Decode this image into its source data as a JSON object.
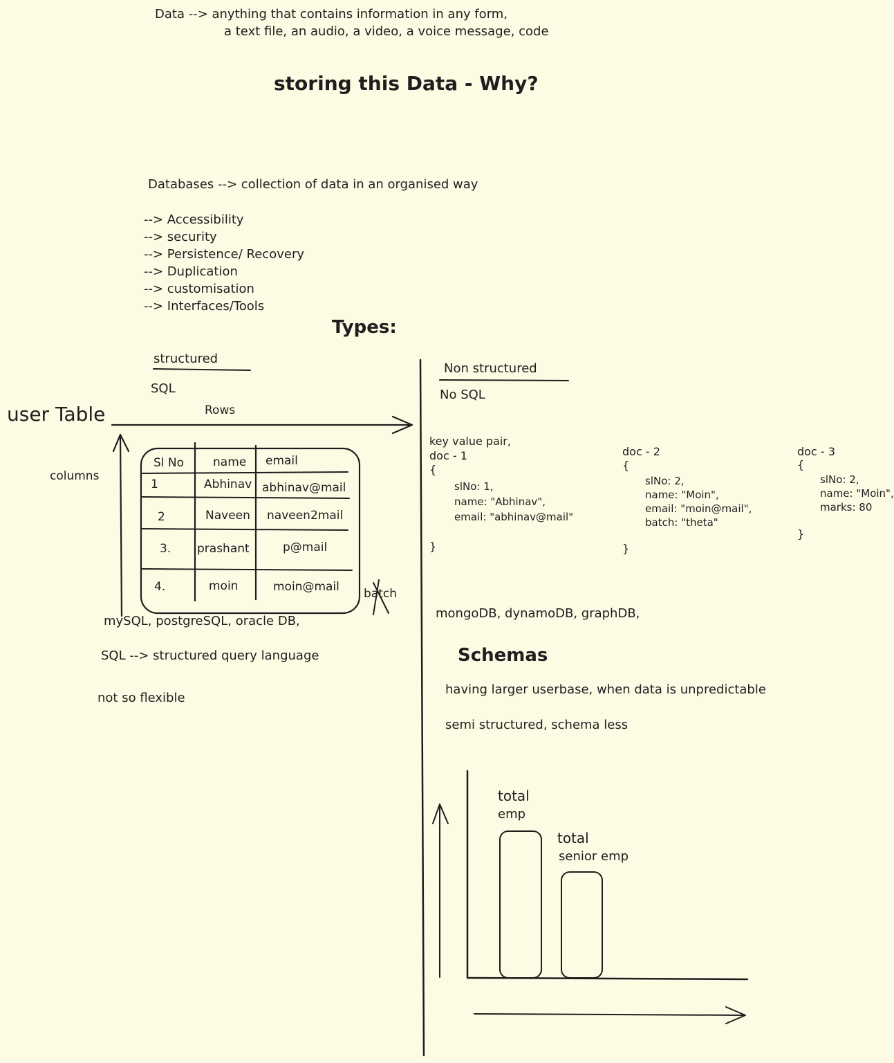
{
  "intro": {
    "line1": "Data --> anything that contains information in any form,",
    "line2": "a text file, an audio, a video, a voice message, code"
  },
  "heading_why": "storing this Data - Why?",
  "databases_definition": "Databases --> collection of data in an organised way",
  "benefits": [
    "--> Accessibility",
    "--> security",
    "--> Persistence/ Recovery",
    "--> Duplication",
    "--> customisation",
    "--> Interfaces/Tools"
  ],
  "types_heading": "Types:",
  "structured": {
    "heading": "structured",
    "sql_label": "SQL",
    "table_title": "user Table",
    "rows_label": "Rows",
    "columns_label": "columns",
    "headers": [
      "Sl No",
      "name",
      "email"
    ],
    "rows": [
      [
        "1",
        "Abhinav",
        "abhinav@mail"
      ],
      [
        "2",
        "Naveen",
        "naveen2mail"
      ],
      [
        "3.",
        "prashant",
        "p@mail"
      ],
      [
        "4.",
        "moin",
        "moin@mail"
      ]
    ],
    "struck_column": "batch",
    "examples": "mySQL, postgreSQL, oracle DB,",
    "sql_definition": "SQL --> structured query language",
    "flexibility": "not so flexible"
  },
  "non_structured": {
    "heading": "Non structured",
    "nosql_label": "No SQL",
    "kv_label": "key value pair,",
    "docs": [
      {
        "title": "doc - 1",
        "open": "{",
        "fields": [
          "slNo: 1,",
          "name: \"Abhinav\",",
          "email: \"abhinav@mail\""
        ],
        "close": "}"
      },
      {
        "title": "doc - 2",
        "open": "{",
        "fields": [
          "slNo: 2,",
          "name: \"Moin\",",
          "email: \"moin@mail\",",
          "batch: \"theta\""
        ],
        "close": "}"
      },
      {
        "title": "doc - 3",
        "open": "{",
        "fields": [
          "slNo: 2,",
          "name: \"Moin\",",
          "marks: 80"
        ],
        "close": "}"
      }
    ],
    "examples": "mongoDB, dynamoDB, graphDB,",
    "schemas_heading": "Schemas",
    "use_case": "having larger userbase, when data is unpredictable",
    "semi_structured": "semi structured, schema less"
  },
  "sketch_chart": {
    "bars": [
      {
        "label_line1": "total",
        "label_line2": "emp"
      },
      {
        "label_line1": "total",
        "label_line2": "senior emp"
      }
    ]
  }
}
